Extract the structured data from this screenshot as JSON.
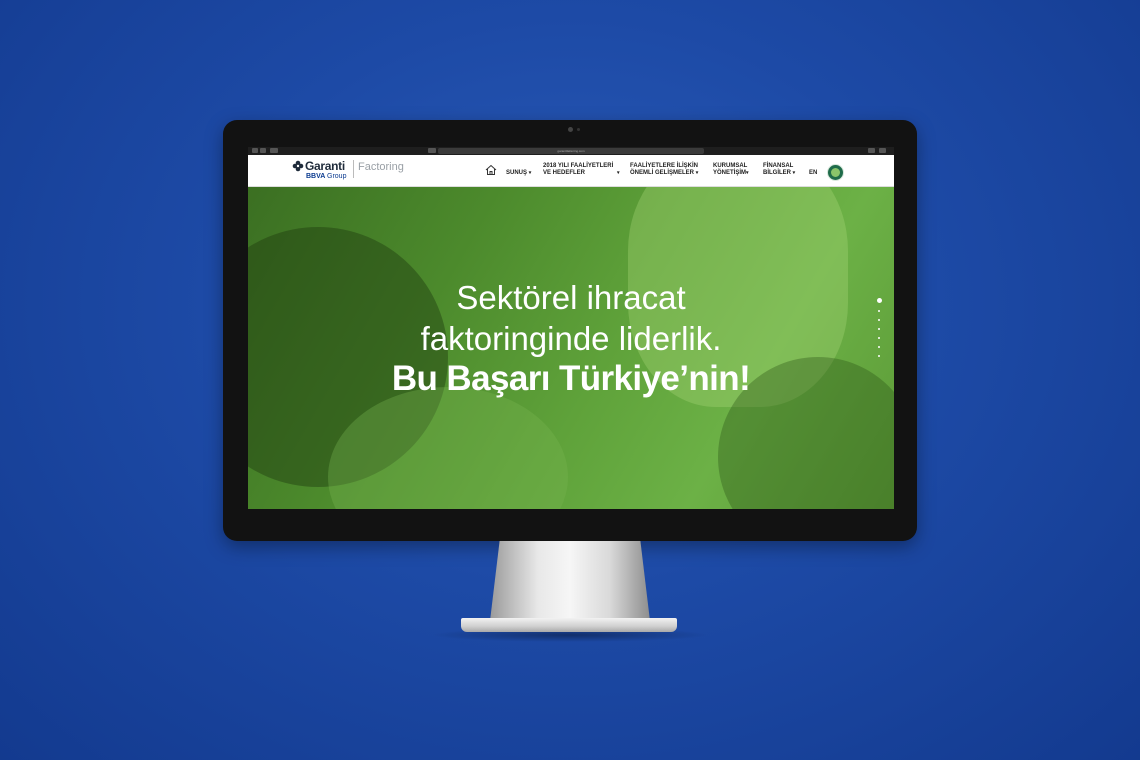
{
  "browser": {
    "url": "garantifaktoring.com"
  },
  "header": {
    "logo": {
      "brand": "Garanti",
      "group_prefix": "BBVA",
      "group_suffix": "Group",
      "product": "Factoring"
    },
    "nav": {
      "home_icon": "home-icon",
      "items": [
        {
          "label_line1": "SUNUŞ",
          "label_line2": ""
        },
        {
          "label_line1": "2018 YILI FAALİYETLERİ",
          "label_line2": "VE HEDEFLER"
        },
        {
          "label_line1": "FAALİYETLERE İLİŞKİN",
          "label_line2": "ÖNEMLİ GELİŞMELER"
        },
        {
          "label_line1": "KURUMSAL",
          "label_line2": "YÖNETİŞİM"
        },
        {
          "label_line1": "FİNANSAL",
          "label_line2": "BİLGİLER"
        }
      ],
      "caret": "▾",
      "language": "EN"
    }
  },
  "hero": {
    "line1": "Sektörel ihracat",
    "line2": "faktoringinde liderlik.",
    "line3": "Bu Başarı Türkiye’nin!",
    "slides_total": 7,
    "active_slide": 1
  },
  "colors": {
    "background": "#1d4aa6",
    "hero_green": "#5fa23a",
    "brand_navy": "#0a3a8f"
  }
}
